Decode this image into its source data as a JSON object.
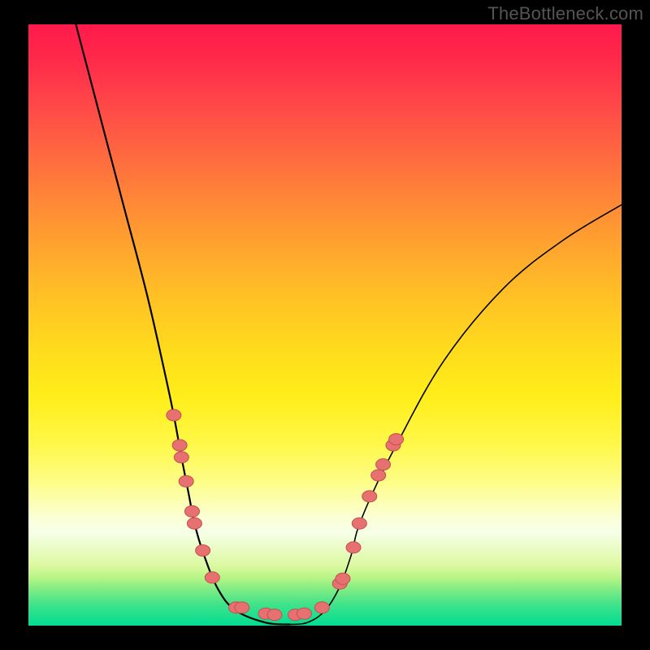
{
  "watermark": "TheBottleneck.com",
  "colors": {
    "background_black": "#000000",
    "gradient_top": "#ff1a4b",
    "gradient_bottom": "#00dd92",
    "curve": "#000000",
    "dots_fill": "#e77070",
    "dots_stroke": "#c35050"
  },
  "chart_data": {
    "type": "line",
    "title": "",
    "xlabel": "",
    "ylabel": "",
    "xlim": [
      0,
      1
    ],
    "ylim": [
      0,
      1
    ],
    "grid": false,
    "legend": false,
    "series": [
      {
        "name": "left-branch",
        "x": [
          0.08,
          0.12,
          0.16,
          0.2,
          0.23,
          0.245,
          0.258,
          0.27,
          0.28,
          0.295,
          0.32,
          0.35,
          0.4,
          0.44
        ],
        "y": [
          1.0,
          0.85,
          0.7,
          0.55,
          0.42,
          0.35,
          0.28,
          0.22,
          0.17,
          0.12,
          0.06,
          0.025,
          0.005,
          0.002
        ]
      },
      {
        "name": "right-branch",
        "x": [
          0.44,
          0.47,
          0.5,
          0.525,
          0.545,
          0.555,
          0.58,
          0.62,
          0.7,
          0.8,
          0.9,
          1.0
        ],
        "y": [
          0.002,
          0.005,
          0.025,
          0.065,
          0.12,
          0.16,
          0.22,
          0.3,
          0.44,
          0.56,
          0.64,
          0.7
        ]
      }
    ],
    "markers": {
      "name": "highlight-dots",
      "points": [
        {
          "x": 0.245,
          "y": 0.35
        },
        {
          "x": 0.255,
          "y": 0.3
        },
        {
          "x": 0.258,
          "y": 0.28
        },
        {
          "x": 0.266,
          "y": 0.24
        },
        {
          "x": 0.276,
          "y": 0.19
        },
        {
          "x": 0.28,
          "y": 0.17
        },
        {
          "x": 0.294,
          "y": 0.125
        },
        {
          "x": 0.31,
          "y": 0.08
        },
        {
          "x": 0.35,
          "y": 0.03
        },
        {
          "x": 0.36,
          "y": 0.03
        },
        {
          "x": 0.4,
          "y": 0.02
        },
        {
          "x": 0.415,
          "y": 0.018
        },
        {
          "x": 0.45,
          "y": 0.018
        },
        {
          "x": 0.465,
          "y": 0.02
        },
        {
          "x": 0.495,
          "y": 0.03
        },
        {
          "x": 0.525,
          "y": 0.07
        },
        {
          "x": 0.53,
          "y": 0.078
        },
        {
          "x": 0.548,
          "y": 0.13
        },
        {
          "x": 0.558,
          "y": 0.17
        },
        {
          "x": 0.575,
          "y": 0.215
        },
        {
          "x": 0.59,
          "y": 0.25
        },
        {
          "x": 0.598,
          "y": 0.268
        },
        {
          "x": 0.615,
          "y": 0.3
        },
        {
          "x": 0.62,
          "y": 0.31
        }
      ]
    }
  }
}
